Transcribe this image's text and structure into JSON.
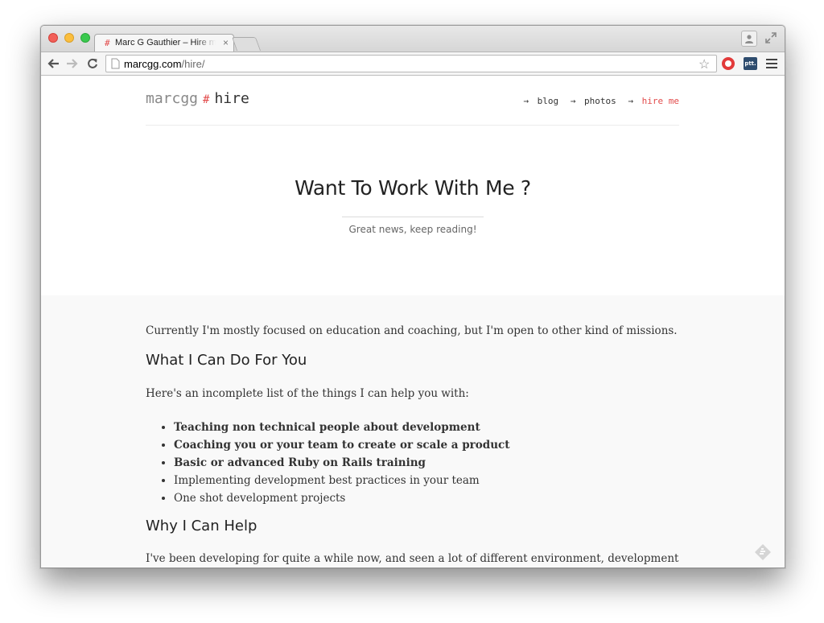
{
  "browser": {
    "tab": {
      "title": "Marc G Gauthier – Hire me",
      "hash_glyph": "#",
      "close_glyph": "×"
    },
    "url": {
      "domain": "marcgg.com",
      "path": "/hire/"
    },
    "extensions": {
      "ext2_label": "ptt."
    }
  },
  "site": {
    "logo": {
      "name": "marcgg",
      "hash": "#",
      "section": "hire"
    },
    "nav": [
      {
        "arrow": "→",
        "label": "blog"
      },
      {
        "arrow": "→",
        "label": "photos"
      },
      {
        "arrow": "→",
        "label": "hire me",
        "active": true
      }
    ]
  },
  "hero": {
    "title": "Want To Work With Me ?",
    "subtitle": "Great news, keep reading!"
  },
  "article": {
    "intro": "Currently I'm mostly focused on education and coaching, but I'm open to other kind of missions.",
    "heading1": "What I Can Do For You",
    "list_intro": "Here's an incomplete list of the things I can help you with:",
    "items": [
      "Teaching non technical people about development",
      "Coaching you or your team to create or scale a product",
      "Basic or advanced Ruby on Rails training",
      "Implementing development best practices in your team",
      "One shot development projects"
    ],
    "heading2": "Why I Can Help",
    "para3": "I've been developing for quite a while now, and seen a lot of different environment, development"
  },
  "colors": {
    "accent": "#e24b4b",
    "hero_bg": "#ffffff",
    "body_bg": "#f9f9f9"
  }
}
